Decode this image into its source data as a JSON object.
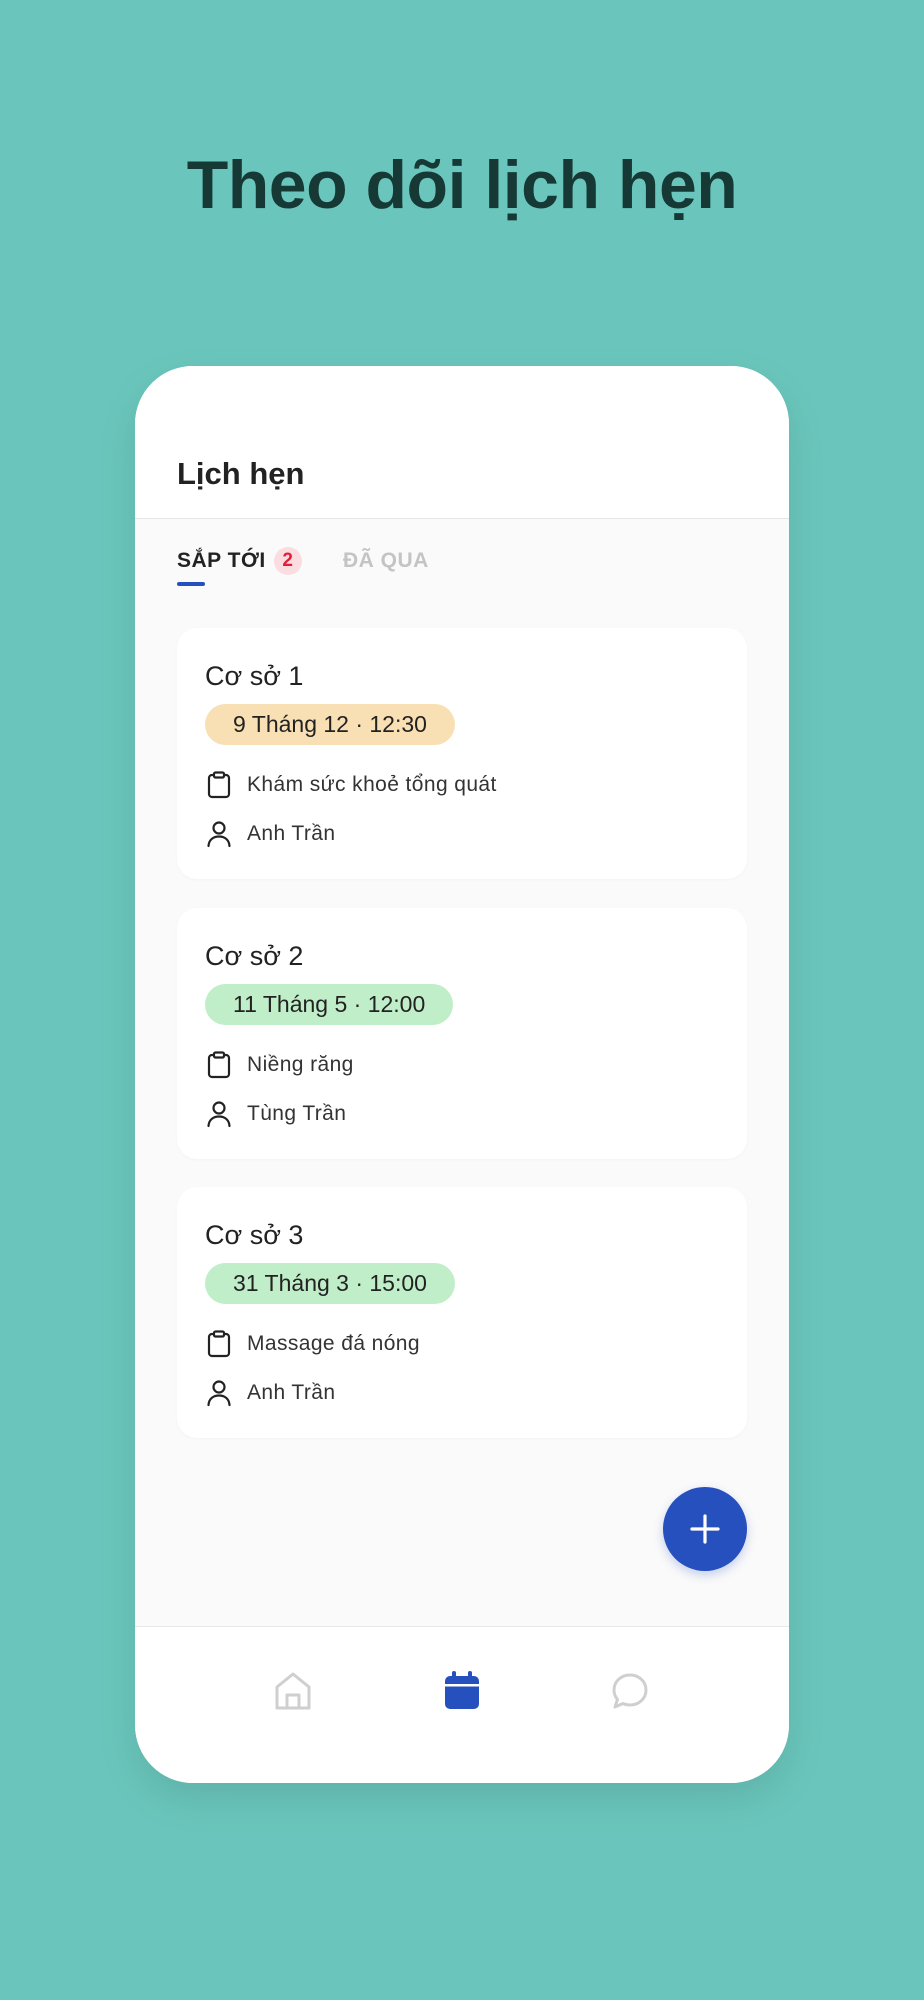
{
  "headline": "Theo dõi lịch hẹn",
  "appbar": {
    "title": "Lịch hẹn"
  },
  "tabs": [
    {
      "label": "SẮP TỚI",
      "badge": "2",
      "active": true
    },
    {
      "label": "ĐÃ QUA",
      "active": false
    }
  ],
  "appointments": [
    {
      "location": "Cơ sở 1",
      "datetime": "9 Tháng 12 · 12:30",
      "pill_color": "#f8dfb4",
      "service": "Khám sức khoẻ tổng quát",
      "person": "Anh Trần"
    },
    {
      "location": "Cơ sở 2",
      "datetime": "11 Tháng 5 · 12:00",
      "pill_color": "#c0eec9",
      "service": "Niềng răng",
      "person": "Tùng Trần"
    },
    {
      "location": "Cơ sở 3",
      "datetime": "31 Tháng 3 · 15:00",
      "pill_color": "#c0eec9",
      "service": "Massage đá nóng",
      "person": "Anh Trần"
    }
  ],
  "fab_icon": "plus-icon",
  "bottom_nav": [
    {
      "icon": "home-icon",
      "active": false
    },
    {
      "icon": "calendar-icon",
      "active": true
    },
    {
      "icon": "chat-icon",
      "active": false
    }
  ],
  "colors": {
    "background": "#6ac6bc",
    "headline": "#163936",
    "accent": "#2550be",
    "badge_bg": "#fbdde1",
    "badge_text": "#e0203a",
    "inactive": "#c4c4c4"
  }
}
